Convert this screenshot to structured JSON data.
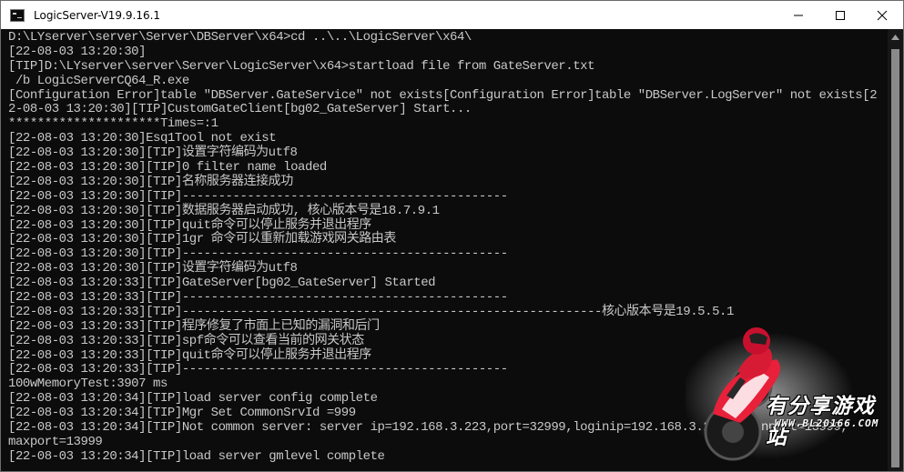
{
  "window": {
    "title": "LogicServer-V19.9.16.1"
  },
  "console": {
    "lines": [
      "D:\\LYserver\\server\\Server\\DBServer\\x64>cd ..\\..\\LogicServer\\x64\\",
      "[22-08-03 13:20:30]",
      "[TIP]D:\\LYserver\\server\\Server\\LogicServer\\x64>startload file from GateServer.txt",
      " /b LogicServerCQ64_R.exe",
      "[Configuration Error]table \"DBServer.GateService\" not exists[Configuration Error]table \"DBServer.LogServer\" not exists[2",
      "2-08-03 13:20:30][TIP]CustomGateClient[bg02_GateServer] Start...",
      "*********************Times=:1",
      "[22-08-03 13:20:30]Esq1Tool not exist",
      "[22-08-03 13:20:30][TIP]设置字符编码为utf8",
      "[22-08-03 13:20:30][TIP]0 filter name loaded",
      "[22-08-03 13:20:30][TIP]名称服务器连接成功",
      "[22-08-03 13:20:30][TIP]---------------------------------------------",
      "[22-08-03 13:20:30][TIP]数据服务器启动成功, 核心版本号是18.7.9.1",
      "[22-08-03 13:20:30][TIP]quit命令可以停止服务并退出程序",
      "[22-08-03 13:20:30][TIP]1gr 命令可以重新加载游戏网关路由表",
      "[22-08-03 13:20:30][TIP]---------------------------------------------",
      "[22-08-03 13:20:30][TIP]设置字符编码为utf8",
      "[22-08-03 13:20:33][TIP]GateServer[bg02_GateServer] Started",
      "[22-08-03 13:20:33][TIP]---------------------------------------------",
      "[22-08-03 13:20:33][TIP]----------------------------------------------------------核心版本号是19.5.5.1",
      "[22-08-03 13:20:33][TIP]程序修复了市面上已知的漏洞和后门",
      "[22-08-03 13:20:33][TIP]spf命令可以查看当前的网关状态",
      "[22-08-03 13:20:33][TIP]quit命令可以停止服务并退出程序",
      "[22-08-03 13:20:33][TIP]---------------------------------------------",
      "100wMemoryTest:3907 ms",
      "[22-08-03 13:20:34][TIP]load server config complete",
      "[22-08-03 13:20:34][TIP]Mgr Set CommonSrvId =999",
      "[22-08-03 13:20:34][TIP]Not common server: server ip=192.168.3.223,port=32999,loginip=192.168.3.223,loginport=13999,",
      "maxport=13999",
      "[22-08-03 13:20:34][TIP]load server gmlevel complete"
    ]
  },
  "watermark": {
    "name": "有分享游戏站",
    "url": "WWW.BL20166.COM"
  },
  "colors": {
    "console_bg": "#0c0c0c",
    "console_text": "#c8c8c8",
    "titlebar_bg": "#ffffff"
  }
}
